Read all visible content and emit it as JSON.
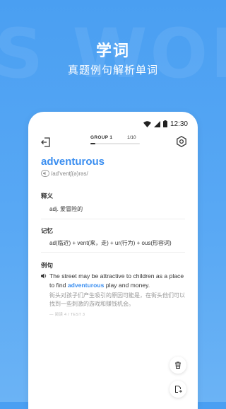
{
  "promo": {
    "watermark": "S WOR",
    "title": "学词",
    "subtitle": "真题例句解析单词"
  },
  "status_bar": {
    "time": "12:30",
    "icons": [
      "wifi-icon",
      "signal-icon",
      "battery-icon"
    ]
  },
  "toolbar": {
    "exit_icon": "exit-icon",
    "group_label": "GROUP 1",
    "group_count": "1/10",
    "progress_fraction": 0.1,
    "settings_icon": "gear-icon"
  },
  "word": {
    "text": "adventurous",
    "phonetic": "/ad'ventʃ(ə)rəs/",
    "audio_icon": "speaker-icon"
  },
  "sections": {
    "definition": {
      "title": "释义",
      "body": "adj. 爱冒险的"
    },
    "memory": {
      "title": "记忆",
      "body": "ad(临近) + vent(来，走) + ur(行为) + ous(形容词)"
    },
    "example": {
      "title": "例句",
      "en_before": "The street may be attractive to children as a place to find ",
      "en_highlight": "adventurous",
      "en_after": " play and money.",
      "cn": "街头对孩子们产生吸引的原因可能是，在街头他们可以找到一些刺激的游戏和赚钱机会。",
      "source": "— 阅读 4 / TEST 3"
    }
  },
  "actions": {
    "delete_icon": "trash-icon",
    "export_icon": "export-icon"
  },
  "colors": {
    "accent": "#3a8ef0",
    "background_top": "#4a9ff2",
    "background_bottom": "#6bb3f5"
  }
}
